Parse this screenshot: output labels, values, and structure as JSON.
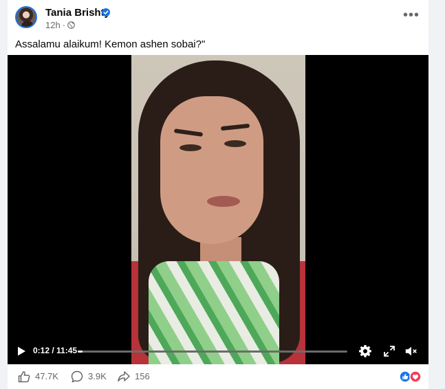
{
  "post": {
    "author": "Tania Brishty",
    "time": "12h",
    "separator": "·",
    "text": "Assalamu alaikum! Kemon ashen sobai?\"",
    "more_label": "•••"
  },
  "video": {
    "time": "0:12 / 11:45",
    "progress": 0.017
  },
  "footer": {
    "likes": "47.7K",
    "comments": "3.9K",
    "shares": "156"
  },
  "colors": {
    "verified": "#1b74e4",
    "like": "#1877f2",
    "love": "#f33e58"
  },
  "icons": {
    "verified": "verified-badge-icon",
    "privacy": "globe-icon",
    "play": "play-icon",
    "settings": "gear-icon",
    "fullscreen": "fullscreen-icon",
    "volume": "muted-icon",
    "like": "like-icon",
    "comment": "comment-icon",
    "share": "share-icon"
  }
}
